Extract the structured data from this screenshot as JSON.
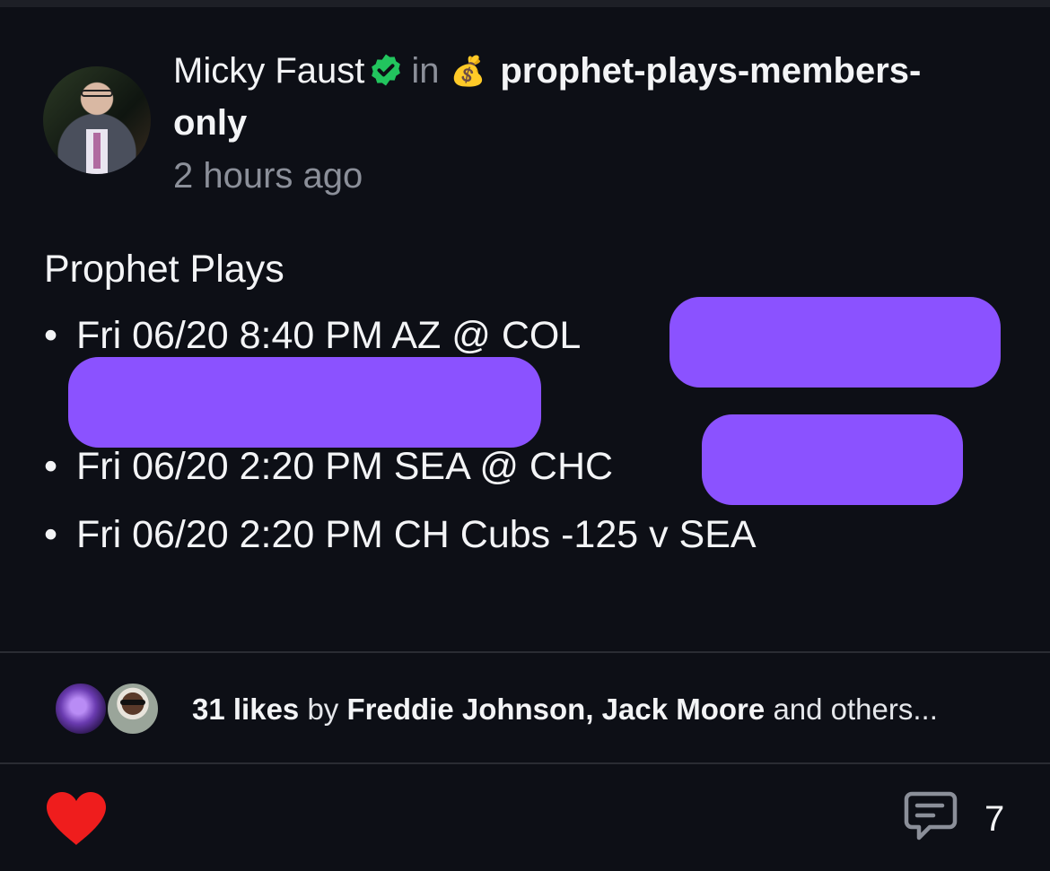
{
  "post": {
    "author": "Micky Faust",
    "in_label": "in",
    "channel_icon": "money-bag-emoji",
    "channel_line1": "prophet-plays-members-",
    "channel_line2": "only",
    "timestamp": "2 hours ago",
    "title": "Prophet Plays",
    "plays": [
      "Fri 06/20 8:40 PM AZ @ COL",
      "Fri 06/20 2:20 PM SEA @ CHC",
      "Fri 06/20 2:20 PM CH Cubs -125 v SEA"
    ]
  },
  "likes": {
    "count_label": "31 likes",
    "by_label": "by",
    "names": "Freddie Johnson, Jack Moore",
    "suffix": "and others..."
  },
  "footer": {
    "comment_count": "7"
  },
  "colors": {
    "background": "#0d0f16",
    "verified": "#22c55e",
    "redaction": "#8b52ff",
    "heart": "#ef1d1d",
    "muted_text": "#8b8f99"
  }
}
